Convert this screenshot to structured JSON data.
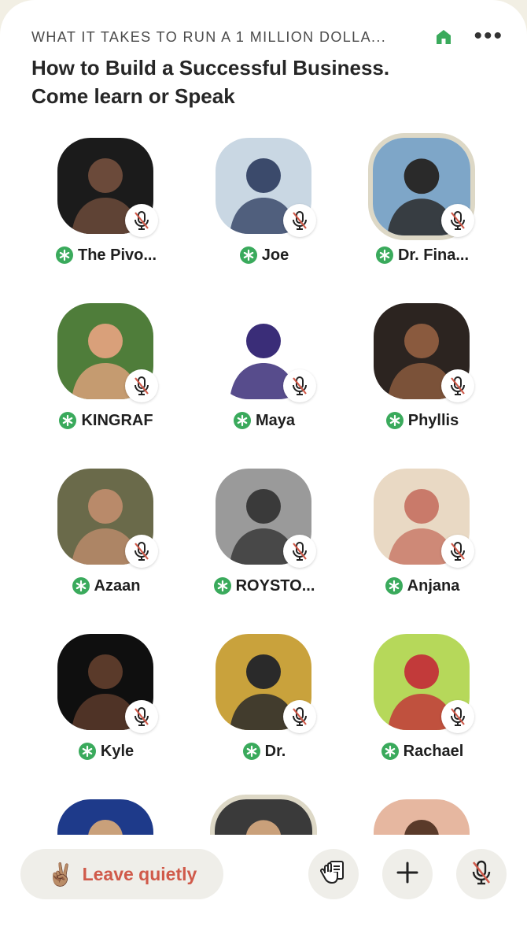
{
  "room": {
    "club_name": "WHAT IT TAKES TO RUN A 1 MILLION DOLLA...",
    "title_line1": "How to Build a Successful Business.",
    "title_line2": "Come learn or Speak"
  },
  "colors": {
    "moderator_green": "#3aaa5c",
    "leave_red": "#d05a4a",
    "ring": "#ddd8c6"
  },
  "speakers": [
    {
      "name": "The Pivo...",
      "bg": "#1b1b1b",
      "fg": "#6b4a3a"
    },
    {
      "name": "Joe",
      "bg": "#c9d7e3",
      "fg": "#3b4a6b"
    },
    {
      "name": "Dr. Fina...",
      "bg": "#7ea6c8",
      "fg": "#2a2a2a"
    },
    {
      "name": "KINGRAF",
      "bg": "#4f7d3a",
      "fg": "#d9a07a"
    },
    {
      "name": "Maya",
      "bg": "#ffffff",
      "fg": "#3a2d78"
    },
    {
      "name": "Phyllis",
      "bg": "#2c2420",
      "fg": "#8a5a3e"
    },
    {
      "name": "Azaan",
      "bg": "#6a6a4a",
      "fg": "#b98a6a"
    },
    {
      "name": "ROYSTO...",
      "bg": "#9a9a9a",
      "fg": "#3a3a3a"
    },
    {
      "name": "Anjana",
      "bg": "#e9d9c4",
      "fg": "#c97a6a"
    },
    {
      "name": "Kyle",
      "bg": "#0f0f0f",
      "fg": "#5a3a2a"
    },
    {
      "name": "Dr.",
      "bg": "#c9a23c",
      "fg": "#2a2a2a"
    },
    {
      "name": "Rachael",
      "bg": "#b6d85a",
      "fg": "#c23a3a"
    },
    {
      "name": "",
      "bg": "#1e3a8a",
      "fg": "#c9a07a"
    },
    {
      "name": "",
      "bg": "#3a3a3a",
      "fg": "#c9a07a"
    },
    {
      "name": "",
      "bg": "#e6b7a0",
      "fg": "#5a3a2a"
    }
  ],
  "bottom": {
    "leave_emoji": "✌🏽",
    "leave_label": "Leave quietly",
    "raise_hand_icon": "raise-hand-icon",
    "add_icon": "plus-icon",
    "mic_icon": "mic-muted-icon"
  }
}
